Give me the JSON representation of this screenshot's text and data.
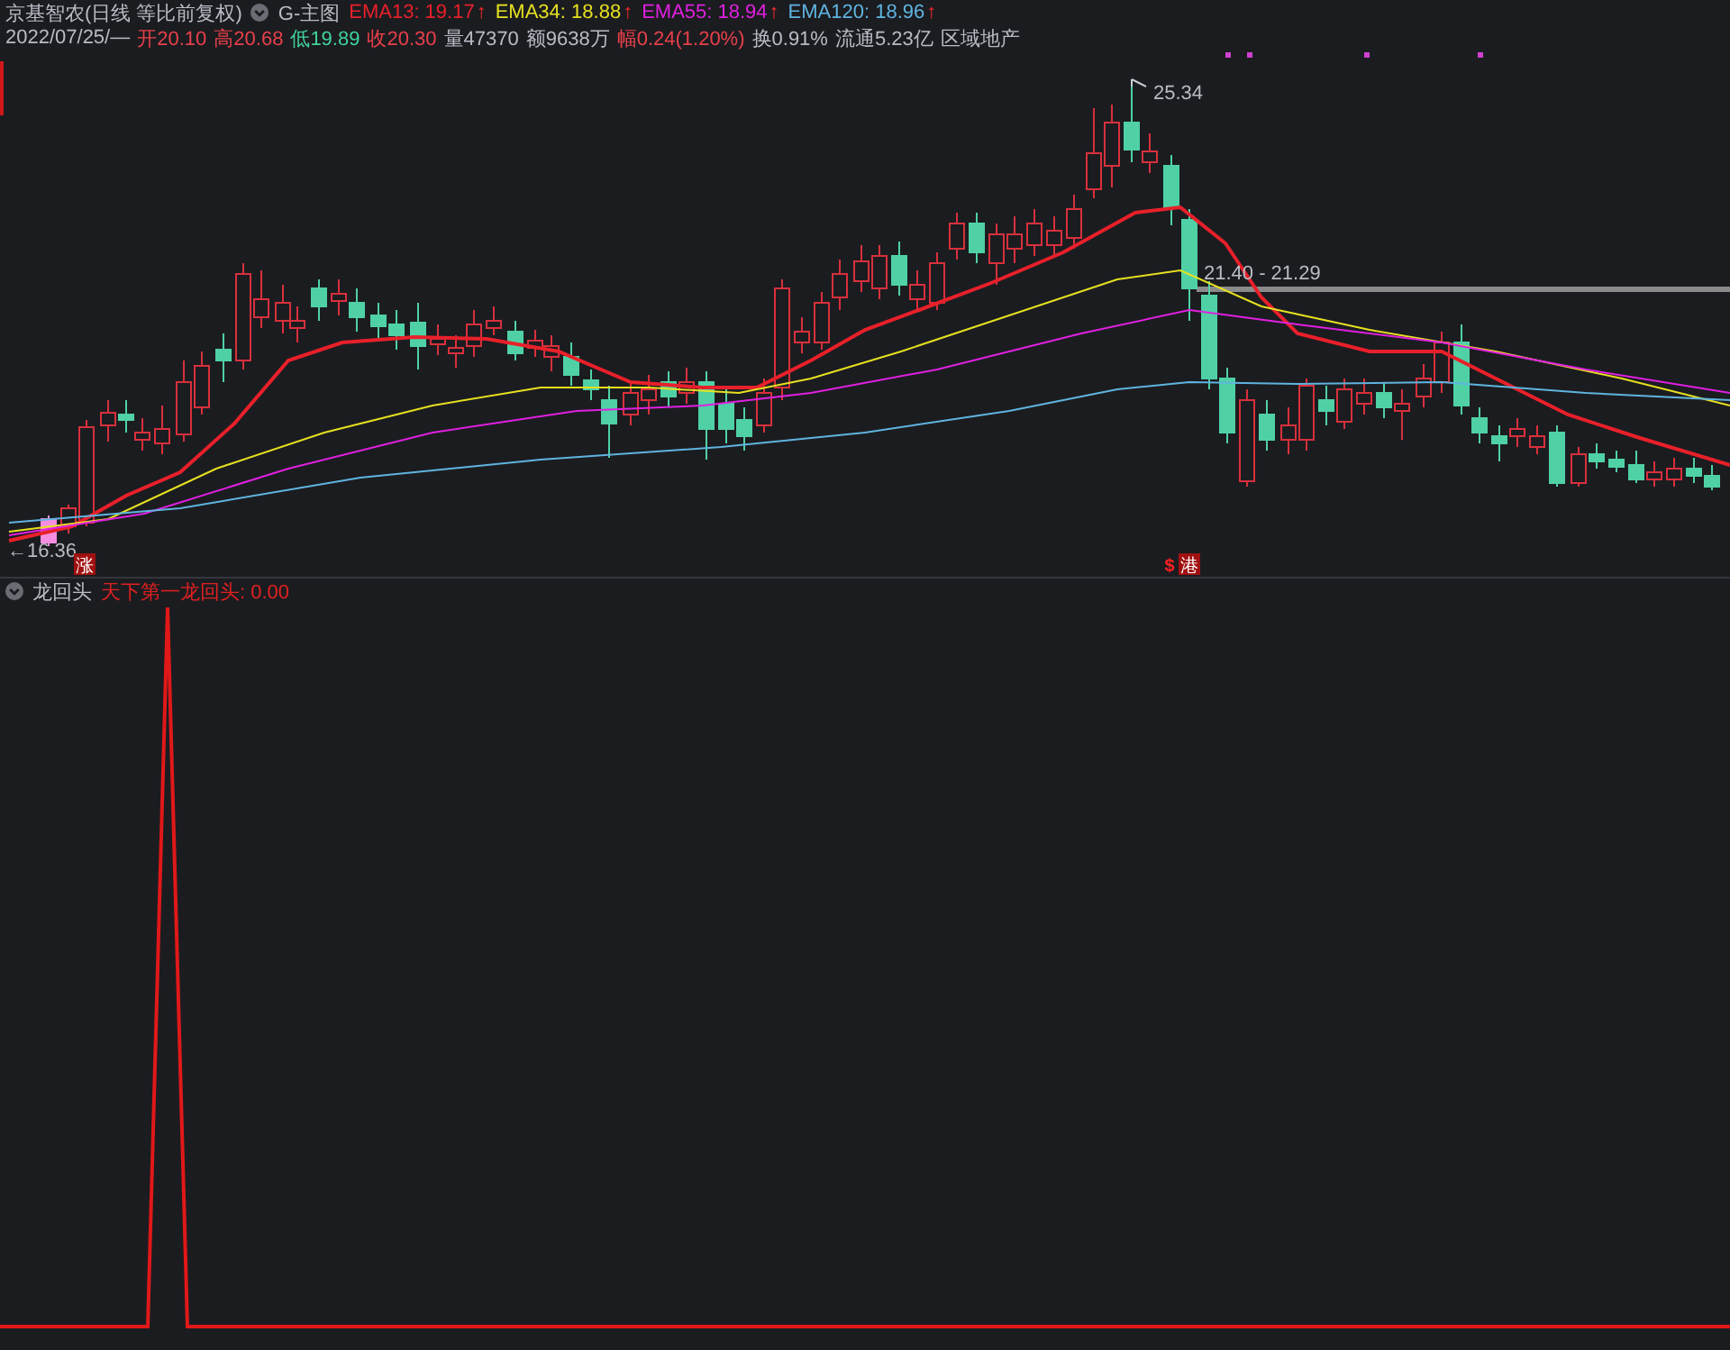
{
  "header": {
    "title": "京基智农(日线 等比前复权)",
    "template": "G-主图",
    "indicators": [
      {
        "label": "EMA13: 19.17",
        "color": "#e8202a",
        "arrow": "↑"
      },
      {
        "label": "EMA34: 18.88",
        "color": "#e6e020",
        "arrow": "↑"
      },
      {
        "label": "EMA55: 18.94",
        "color": "#e020e0",
        "arrow": "↑"
      },
      {
        "label": "EMA120: 18.96",
        "color": "#5fb4e0",
        "arrow": "↑"
      }
    ]
  },
  "quote": [
    {
      "text": "2022/07/25/—",
      "kind": "neutral"
    },
    {
      "text": "开20.10",
      "kind": "up"
    },
    {
      "text": "高20.68",
      "kind": "up"
    },
    {
      "text": "低19.89",
      "kind": "down"
    },
    {
      "text": "收20.30",
      "kind": "up"
    },
    {
      "text": "量47370",
      "kind": "neutral"
    },
    {
      "text": "额9638万",
      "kind": "neutral"
    },
    {
      "text": "幅0.24(1.20%)",
      "kind": "up"
    },
    {
      "text": "换0.91%",
      "kind": "neutral"
    },
    {
      "text": "流通5.23亿",
      "kind": "neutral"
    },
    {
      "text": "区域地产",
      "kind": "neutral"
    }
  ],
  "chart": {
    "high_label": "25.34",
    "low_label": "←16.36",
    "range_label": "21.40 - 21.29",
    "markers": [
      {
        "text": "涨",
        "kind": "badge"
      },
      {
        "text": "$",
        "kind": "symbol"
      },
      {
        "text": "港",
        "kind": "badge"
      }
    ]
  },
  "indicator_panel": {
    "name": "龙回头",
    "formula": "天下第一龙回头: 0.00"
  }
}
